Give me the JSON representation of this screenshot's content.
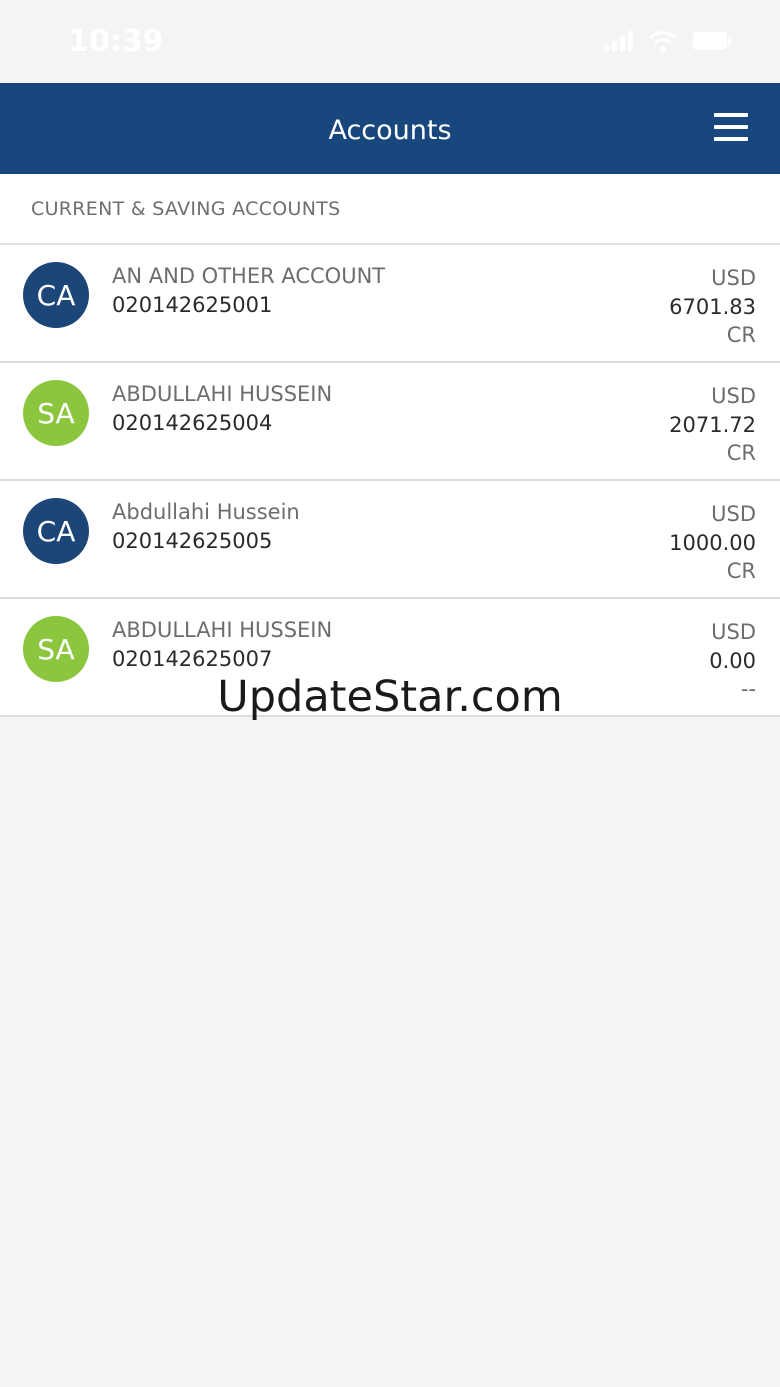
{
  "status_bar": {
    "time": "10:39"
  },
  "header": {
    "title": "Accounts",
    "menu_icon": "hamburger-menu-icon"
  },
  "section": {
    "label": "CURRENT & SAVING ACCOUNTS"
  },
  "colors": {
    "nav": "#18477d",
    "ca_avatar": "#1c4578",
    "sa_avatar": "#8cc63f"
  },
  "accounts": [
    {
      "initials": "CA",
      "name": "AN AND OTHER ACCOUNT",
      "number": "020142625001",
      "currency": "USD",
      "balance": "6701.83",
      "type": "CR"
    },
    {
      "initials": "SA",
      "name": "ABDULLAHI HUSSEIN",
      "number": "020142625004",
      "currency": "USD",
      "balance": "2071.72",
      "type": "CR"
    },
    {
      "initials": "CA",
      "name": "Abdullahi Hussein",
      "number": "020142625005",
      "currency": "USD",
      "balance": "1000.00",
      "type": "CR"
    },
    {
      "initials": "SA",
      "name": "ABDULLAHI HUSSEIN",
      "number": "020142625007",
      "currency": "USD",
      "balance": "0.00",
      "type": "--"
    }
  ],
  "watermark": "UpdateStar.com"
}
